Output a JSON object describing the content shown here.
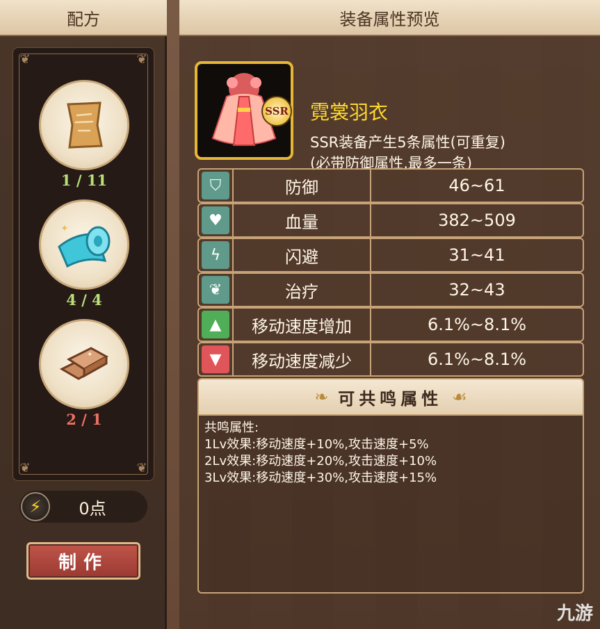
{
  "left": {
    "title": "配方",
    "materials": [
      {
        "icon": "recipe-scroll-icon",
        "count": "1 / 11",
        "sufficient": true
      },
      {
        "icon": "cloth-bolt-icon",
        "count": "4 / 4",
        "sufficient": true
      },
      {
        "icon": "copper-ingot-icon",
        "count": "2 / 1",
        "sufficient": false
      }
    ],
    "points": "0点",
    "make_label": "制作"
  },
  "right": {
    "title": "装备属性预览",
    "item": {
      "name": "霓裳羽衣",
      "rarity": "SSR",
      "desc_line1": "SSR装备产生5条属性(可重复)",
      "desc_line2": "(必带防御属性,最多一条)"
    },
    "stats": [
      {
        "icon": "shield-icon",
        "tile_color": "#5f9a8a",
        "name": "防御",
        "value": "46~61"
      },
      {
        "icon": "heart-icon",
        "tile_color": "#5f9a8a",
        "name": "血量",
        "value": "382~509"
      },
      {
        "icon": "lightning-icon",
        "tile_color": "#5f9a8a",
        "name": "闪避",
        "value": "31~41"
      },
      {
        "icon": "leaf-icon",
        "tile_color": "#5f9a8a",
        "name": "治疗",
        "value": "32~43"
      },
      {
        "icon": "boot-up-icon",
        "tile_color": "#4fae57",
        "name": "移动速度增加",
        "value": "6.1%~8.1%"
      },
      {
        "icon": "boot-down-icon",
        "tile_color": "#e0555a",
        "name": "移动速度减少",
        "value": "6.1%~8.1%"
      }
    ],
    "resonance": {
      "title": "可共鸣属性",
      "label": "共鸣属性:",
      "lines": [
        "1Lv效果:移动速度+10%,攻击速度+5%",
        "2Lv效果:移动速度+20%,攻击速度+10%",
        "3Lv效果:移动速度+30%,攻击速度+15%"
      ]
    }
  },
  "watermark": "九游"
}
